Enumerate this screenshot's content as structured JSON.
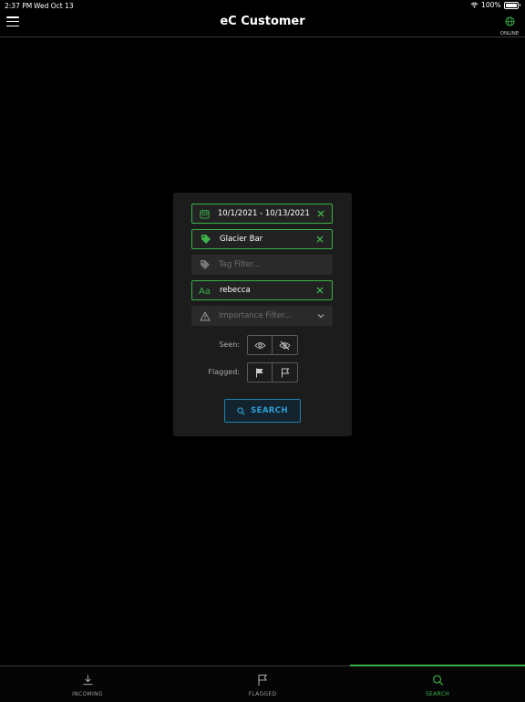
{
  "status_bar": {
    "time": "2:37 PM",
    "date": "Wed Oct 13",
    "battery": "100%"
  },
  "header": {
    "title": "eC Customer",
    "online_label": "ONLINE"
  },
  "filters": {
    "date_range": "10/1/2021 - 10/13/2021",
    "customer": "Glacier Bar",
    "tag_placeholder": "Tag Filter...",
    "text_query": "rebecca",
    "importance_placeholder": "Importance Filter...",
    "seen_label": "Seen:",
    "flagged_label": "Flagged:",
    "search_label": "SEARCH"
  },
  "tabs": [
    {
      "label": "INCOMING",
      "icon": "download-icon"
    },
    {
      "label": "FLAGGED",
      "icon": "flag-icon"
    },
    {
      "label": "SEARCH",
      "icon": "search-icon"
    }
  ],
  "colors": {
    "accent_green": "#3bb34a",
    "accent_blue": "#2f9fd8",
    "background": "#000000",
    "panel": "#1c1c1c"
  }
}
